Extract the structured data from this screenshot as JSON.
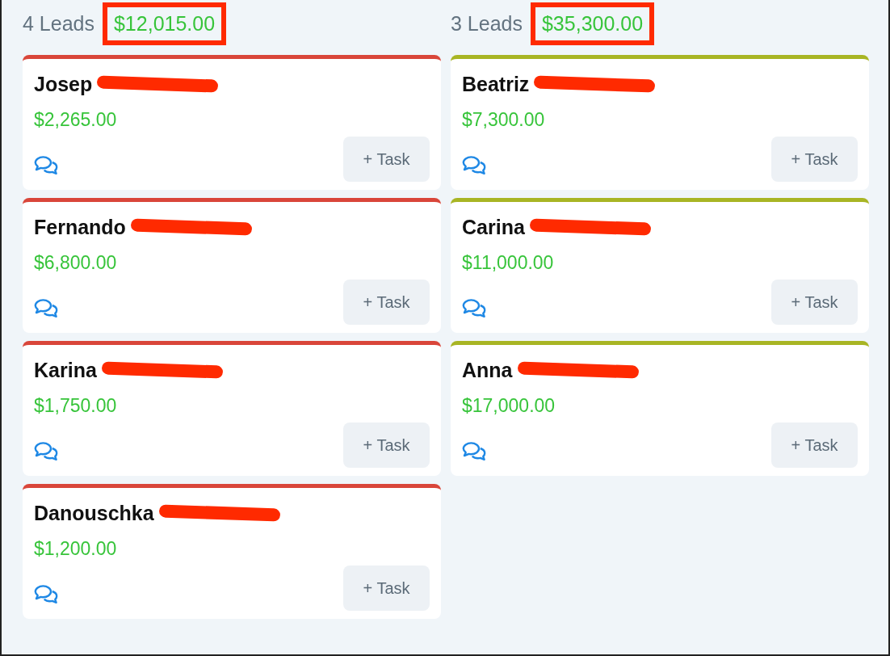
{
  "columns": [
    {
      "count": "4 Leads",
      "total": "$12,015.00",
      "total_highlighted": true,
      "color": "#d9463a",
      "cards": [
        {
          "name": "Josep",
          "amount": "$2,265.00",
          "redacted": true,
          "button": "+ Task"
        },
        {
          "name": "Fernando",
          "amount": "$6,800.00",
          "redacted": true,
          "button": "+ Task"
        },
        {
          "name": "Karina",
          "amount": "$1,750.00",
          "redacted": true,
          "button": "+ Task"
        },
        {
          "name": "Danouschka",
          "amount": "$1,200.00",
          "redacted": true,
          "button": "+ Task"
        }
      ]
    },
    {
      "count": "3 Leads",
      "total": "$35,300.00",
      "total_highlighted": true,
      "color": "#a8b524",
      "cards": [
        {
          "name": "Beatriz",
          "amount": "$7,300.00",
          "redacted": true,
          "button": "+ Task"
        },
        {
          "name": "Carina",
          "amount": "$11,000.00",
          "redacted": true,
          "button": "+ Task"
        },
        {
          "name": "Anna",
          "amount": "$17,000.00",
          "redacted": true,
          "button": "+ Task"
        }
      ]
    }
  ]
}
